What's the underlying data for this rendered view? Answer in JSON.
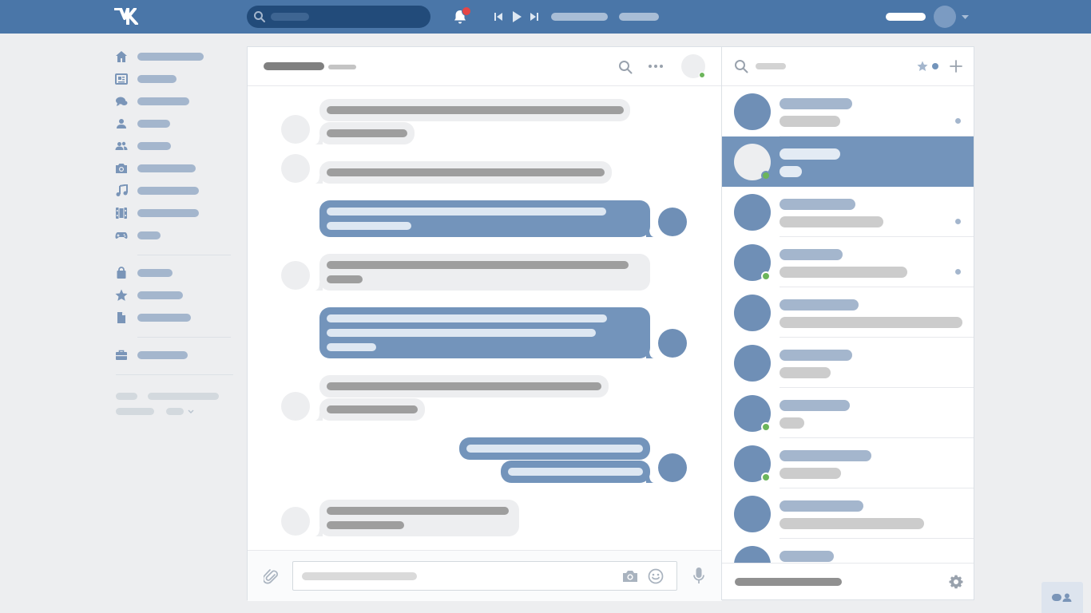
{
  "colors": {
    "header": "#4a76a8",
    "accent": "#7394bb",
    "link_placeholder": "#a4b6cd",
    "online": "#6cb55b",
    "badge": "#e64646"
  },
  "header": {
    "logo_icon": "vk-logo",
    "search_icon": "search-icon",
    "bell_icon": "bell-icon",
    "player_icons": [
      "prev-track-icon",
      "play-icon",
      "next-track-icon"
    ]
  },
  "nav": {
    "items": [
      {
        "icon": "home-icon"
      },
      {
        "icon": "news-icon"
      },
      {
        "icon": "messages-icon"
      },
      {
        "icon": "friends-icon"
      },
      {
        "icon": "communities-icon"
      },
      {
        "icon": "photos-icon"
      },
      {
        "icon": "music-icon"
      },
      {
        "icon": "videos-icon"
      },
      {
        "icon": "games-icon"
      },
      {
        "icon": "market-icon"
      },
      {
        "icon": "bookmarks-icon"
      },
      {
        "icon": "documents-icon"
      },
      {
        "icon": "ads-icon"
      }
    ]
  },
  "chat": {
    "icons": [
      "search-icon",
      "more-icon",
      "attach-icon",
      "camera-icon",
      "emoji-icon",
      "microphone-icon"
    ]
  },
  "conversations": {
    "icons": [
      "search-icon",
      "star-filter-icon",
      "add-icon",
      "settings-icon"
    ],
    "items": [
      {
        "online": false,
        "unread": true
      },
      {
        "online": true,
        "unread": false,
        "active": true
      },
      {
        "online": false,
        "unread": true
      },
      {
        "online": true,
        "unread": true
      },
      {
        "online": false,
        "unread": false
      },
      {
        "online": false,
        "unread": false
      },
      {
        "online": true,
        "unread": false
      },
      {
        "online": true,
        "unread": false
      },
      {
        "online": false,
        "unread": false
      },
      {
        "online": false,
        "unread": false
      }
    ]
  }
}
